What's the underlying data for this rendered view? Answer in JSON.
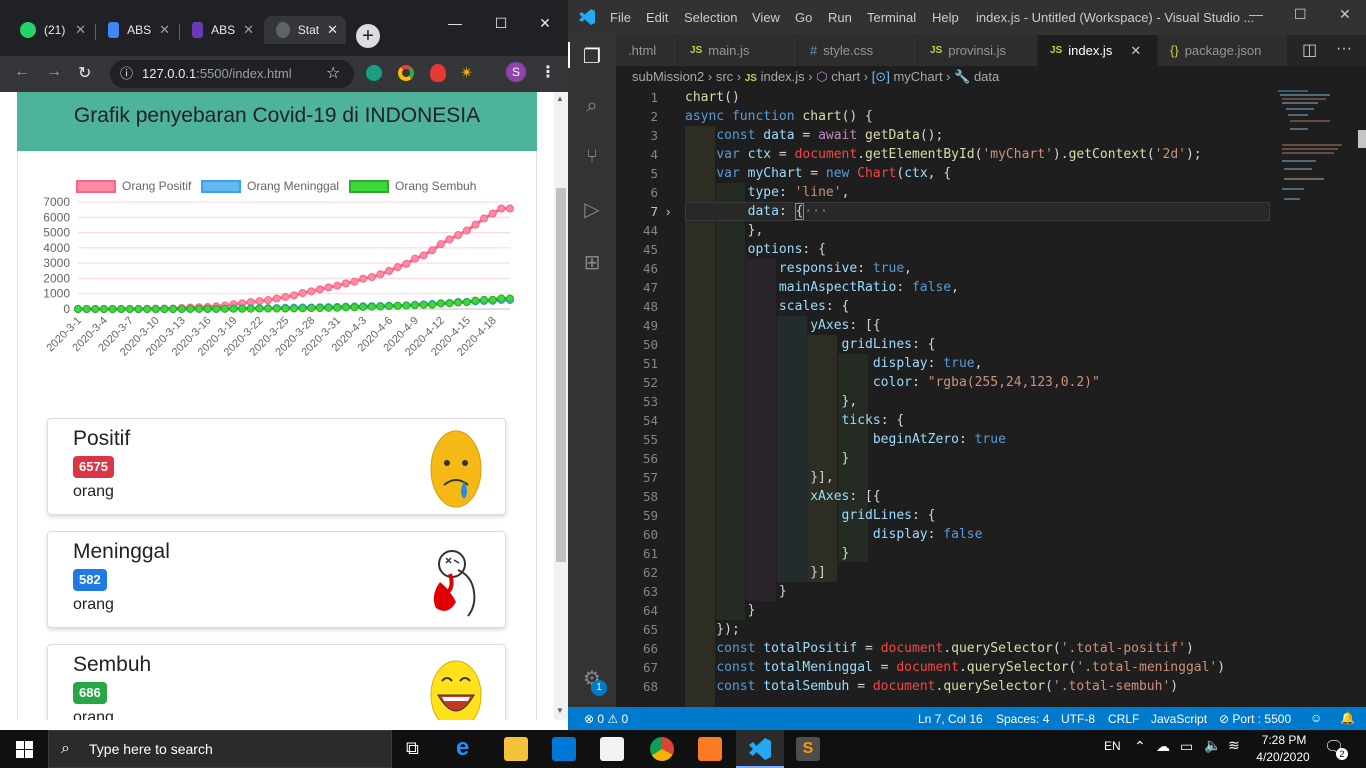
{
  "browser": {
    "tabs": [
      {
        "label": "(21)",
        "close": "✕"
      },
      {
        "label": "ABS",
        "close": "✕"
      },
      {
        "label": "ABS",
        "close": "✕"
      },
      {
        "label": "Stat",
        "close": "✕"
      }
    ],
    "new_tab": "+",
    "window_controls": {
      "minimize": "—",
      "maximize": "☐",
      "close": "✕"
    },
    "url_host": "127.0.0.1",
    "url_rest": ":5500/index.html",
    "profile_initial": "S"
  },
  "page": {
    "title": "Grafik penyebaran Covid-19 di INDONESIA",
    "cards": [
      {
        "title": "Positif",
        "count": "6575",
        "unit": "orang",
        "color": "#dc3545"
      },
      {
        "title": "Meninggal",
        "count": "582",
        "unit": "orang",
        "color": "#1e7be6"
      },
      {
        "title": "Sembuh",
        "count": "686",
        "unit": "orang",
        "color": "#28a745"
      }
    ]
  },
  "chart_data": {
    "type": "line",
    "legend_position": "top",
    "grid": true,
    "ylim": [
      0,
      7000
    ],
    "y_ticks": [
      "7000",
      "6000",
      "5000",
      "4000",
      "3000",
      "2000",
      "1000",
      "0"
    ],
    "x_tick_labels": [
      "2020-3-1",
      "2020-3-4",
      "2020-3-7",
      "2020-3-10",
      "2020-3-13",
      "2020-3-16",
      "2020-3-19",
      "2020-3-22",
      "2020-3-25",
      "2020-3-28",
      "2020-3-31",
      "2020-4-3",
      "2020-4-6",
      "2020-4-9",
      "2020-4-12",
      "2020-4-15",
      "2020-4-18"
    ],
    "x": [
      "2020-3-1",
      "2020-3-2",
      "2020-3-3",
      "2020-3-4",
      "2020-3-5",
      "2020-3-6",
      "2020-3-7",
      "2020-3-8",
      "2020-3-9",
      "2020-3-10",
      "2020-3-11",
      "2020-3-12",
      "2020-3-13",
      "2020-3-14",
      "2020-3-15",
      "2020-3-16",
      "2020-3-17",
      "2020-3-18",
      "2020-3-19",
      "2020-3-20",
      "2020-3-21",
      "2020-3-22",
      "2020-3-23",
      "2020-3-24",
      "2020-3-25",
      "2020-3-26",
      "2020-3-27",
      "2020-3-28",
      "2020-3-29",
      "2020-3-30",
      "2020-3-31",
      "2020-4-1",
      "2020-4-2",
      "2020-4-3",
      "2020-4-4",
      "2020-4-5",
      "2020-4-6",
      "2020-4-7",
      "2020-4-8",
      "2020-4-9",
      "2020-4-10",
      "2020-4-11",
      "2020-4-12",
      "2020-4-13",
      "2020-4-14",
      "2020-4-15",
      "2020-4-16",
      "2020-4-17",
      "2020-4-18",
      "2020-4-19",
      "2020-4-20"
    ],
    "series": [
      {
        "name": "Orang Positif",
        "color": "#ff6384",
        "fill": "#ff8aa5",
        "values": [
          0,
          2,
          2,
          2,
          2,
          4,
          4,
          6,
          19,
          27,
          34,
          34,
          69,
          96,
          117,
          134,
          172,
          227,
          309,
          369,
          450,
          514,
          579,
          686,
          790,
          893,
          1046,
          1155,
          1285,
          1414,
          1528,
          1677,
          1790,
          1986,
          2092,
          2273,
          2491,
          2738,
          2956,
          3293,
          3512,
          3842,
          4241,
          4557,
          4839,
          5136,
          5516,
          5923,
          6248,
          6575,
          6575
        ]
      },
      {
        "name": "Orang Meninggal",
        "color": "#36a2eb",
        "fill": "#63b8f0",
        "values": [
          0,
          0,
          0,
          0,
          0,
          0,
          0,
          0,
          0,
          0,
          1,
          1,
          4,
          5,
          5,
          5,
          7,
          19,
          32,
          38,
          48,
          49,
          55,
          59,
          78,
          87,
          102,
          102,
          114,
          122,
          136,
          157,
          170,
          181,
          191,
          198,
          209,
          221,
          240,
          280,
          306,
          327,
          373,
          399,
          459,
          469,
          496,
          520,
          535,
          582,
          582
        ]
      },
      {
        "name": "Orang Sembuh",
        "color": "#2ea82e",
        "fill": "#3cd83c",
        "values": [
          0,
          0,
          0,
          0,
          0,
          0,
          0,
          0,
          0,
          0,
          0,
          0,
          0,
          8,
          8,
          8,
          8,
          11,
          15,
          16,
          20,
          29,
          30,
          30,
          31,
          35,
          46,
          59,
          64,
          75,
          81,
          103,
          112,
          134,
          150,
          164,
          192,
          204,
          222,
          252,
          282,
          286,
          359,
          380,
          426,
          446,
          548,
          595,
          607,
          686,
          686
        ]
      }
    ]
  },
  "vscode": {
    "menu": [
      "File",
      "Edit",
      "Selection",
      "View",
      "Go",
      "Run",
      "Terminal",
      "Help"
    ],
    "window_title": "index.js - Untitled (Workspace) - Visual Studio ...",
    "tabs": [
      "\u0010.html",
      "main.js",
      "style.css",
      "provinsi.js",
      "index.js",
      "package.json"
    ],
    "breadcrumb": [
      "subMission2",
      "src",
      "index.js",
      "chart",
      "myChart",
      "data"
    ],
    "line_numbers": [
      "1",
      "2",
      "3",
      "4",
      "5",
      "6",
      "7",
      "44",
      "45",
      "46",
      "47",
      "48",
      "49",
      "50",
      "51",
      "52",
      "53",
      "54",
      "55",
      "56",
      "57",
      "58",
      "59",
      "60",
      "61",
      "62",
      "63",
      "64",
      "65",
      "66",
      "67",
      "68"
    ],
    "status": {
      "errors": "0",
      "warnings": "0",
      "position": "Ln 7, Col 16",
      "spaces": "Spaces: 4",
      "encoding": "UTF-8",
      "eol": "CRLF",
      "language": "JavaScript",
      "port": "Port : 5500"
    },
    "badge": "1"
  },
  "taskbar": {
    "search_placeholder": "Type here to search",
    "lang": "EN",
    "time": "7:28 PM",
    "date": "4/20/2020",
    "notifications": "2"
  }
}
